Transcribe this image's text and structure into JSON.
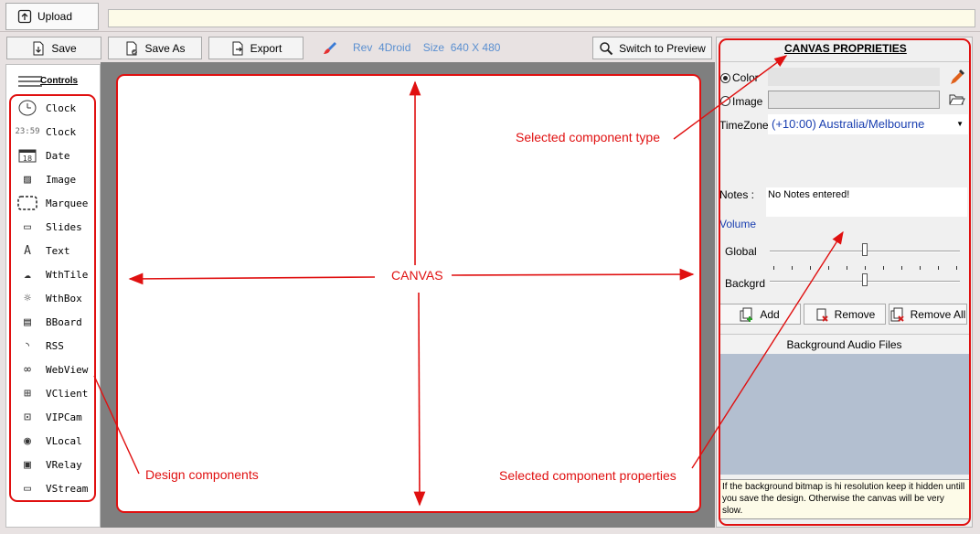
{
  "top": {
    "upload_label": "Upload",
    "url_value": ""
  },
  "toolbar": {
    "save_label": "Save",
    "save_as_label": "Save As",
    "export_label": "Export",
    "rev_label": "Rev",
    "rev_value": "4Droid",
    "size_label": "Size",
    "size_value": "640 X 480",
    "switch_preview_label": "Switch to Preview"
  },
  "controls": {
    "title": "Controls",
    "items": [
      {
        "label": "Clock",
        "icon": "analog-clock-icon"
      },
      {
        "label": "Clock",
        "icon": "digital-clock-icon"
      },
      {
        "label": "Date",
        "icon": "calendar-icon"
      },
      {
        "label": "Image",
        "icon": "image-icon"
      },
      {
        "label": "Marquee",
        "icon": "marquee-icon"
      },
      {
        "label": "Slides",
        "icon": "slides-icon"
      },
      {
        "label": "Text",
        "icon": "text-icon"
      },
      {
        "label": "WthTile",
        "icon": "weather-cloud-icon"
      },
      {
        "label": "WthBox",
        "icon": "sun-icon"
      },
      {
        "label": "BBoard",
        "icon": "board-icon"
      },
      {
        "label": "RSS",
        "icon": "rss-icon"
      },
      {
        "label": "WebView",
        "icon": "link-icon"
      },
      {
        "label": "VClient",
        "icon": "network-icon"
      },
      {
        "label": "VIPCam",
        "icon": "camera-icon"
      },
      {
        "label": "VLocal",
        "icon": "film-reel-icon"
      },
      {
        "label": "VRelay",
        "icon": "relay-icon"
      },
      {
        "label": "VStream",
        "icon": "monitor-icon"
      }
    ]
  },
  "canvas": {
    "label": "CANVAS"
  },
  "annotations": {
    "design_components": "Design components",
    "selected_type": "Selected component type",
    "selected_props": "Selected component properties"
  },
  "props": {
    "title": "CANVAS PROPRIETIES",
    "color_label": "Color",
    "image_label": "Image",
    "timezone_label": "TimeZone",
    "timezone_value": "(+10:00) Australia/Melbourne",
    "notes_label": "Notes :",
    "notes_value": "No Notes entered!",
    "volume_label": "Volume",
    "global_label": "Global",
    "global_level": 0.5,
    "backgrd_label": "Backgrd",
    "backgrd_level": 0.5,
    "add_label": "Add",
    "remove_label": "Remove",
    "remove_all_label": "Remove All",
    "bg_audio_label": "Background Audio Files",
    "hint": "If the background bitmap is hi resolution keep it hidden untill you save the design. Otherwise the canvas will be very slow."
  },
  "colors": {
    "annotation": "#e01010",
    "accent_blue": "#2a63c9",
    "canvas_bg": "#7f7f7f"
  }
}
